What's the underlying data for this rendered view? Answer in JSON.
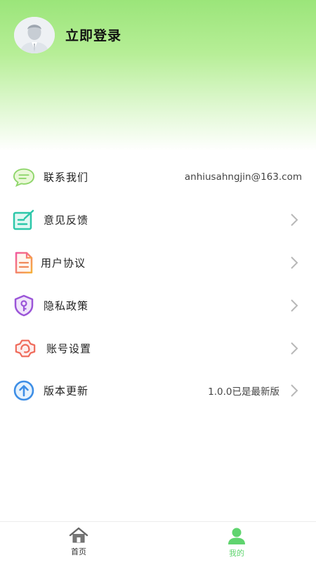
{
  "header": {
    "login_label": "立即登录"
  },
  "menu": [
    {
      "label": "联系我们",
      "value": "anhiusahngjin@163.com",
      "icon": "chat-bubble-icon"
    },
    {
      "label": "意见反馈",
      "value": "",
      "icon": "edit-note-icon"
    },
    {
      "label": "用户协议",
      "value": "",
      "icon": "document-icon"
    },
    {
      "label": "隐私政策",
      "value": "",
      "icon": "shield-key-icon"
    },
    {
      "label": "账号设置",
      "value": "",
      "icon": "settings-gear-icon"
    },
    {
      "label": "版本更新",
      "value": "1.0.0已是最新版",
      "icon": "upload-arrow-icon"
    }
  ],
  "tabbar": {
    "home_label": "首页",
    "mine_label": "我的"
  },
  "colors": {
    "header_green": "#9be57a",
    "active_tab": "#5fd46e"
  }
}
